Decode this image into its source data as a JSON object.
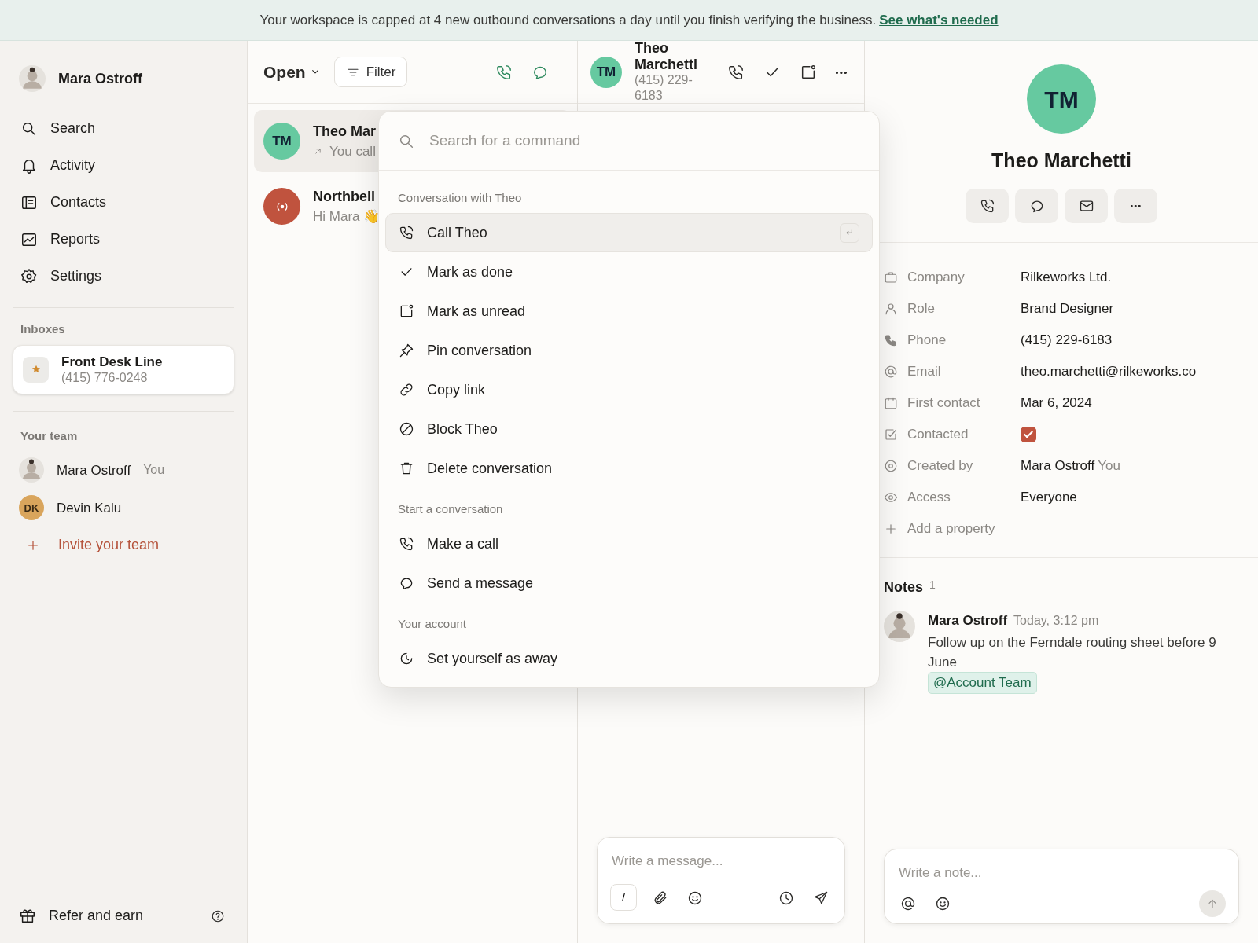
{
  "banner": {
    "text": "Your workspace is capped at 4 new outbound conversations a day until you finish verifying the business.",
    "link": "See what's needed"
  },
  "sidebar": {
    "user": {
      "name": "Mara Ostroff"
    },
    "nav": [
      {
        "label": "Search"
      },
      {
        "label": "Activity"
      },
      {
        "label": "Contacts"
      },
      {
        "label": "Reports"
      },
      {
        "label": "Settings"
      }
    ],
    "inboxes_title": "Inboxes",
    "inboxes": [
      {
        "name": "Front Desk Line",
        "phone": "(415) 776-0248"
      }
    ],
    "team_title": "Your team",
    "team": [
      {
        "kind": "photo",
        "name": "Mara Ostroff",
        "tag": "You"
      },
      {
        "kind": "initials",
        "name": "Devin Kalu",
        "initials": "DK"
      }
    ],
    "invite": "Invite your team",
    "footer": "Refer and earn"
  },
  "list": {
    "view": "Open",
    "filter": "Filter",
    "conversations": [
      {
        "kind": "initials",
        "initials": "TM",
        "color": "#66c9a0",
        "name": "Theo Mar",
        "preview": "You call",
        "selected": true
      },
      {
        "kind": "signal",
        "color": "#c0533e",
        "name": "Northbell",
        "preview": "Hi Mara 👋",
        "selected": false
      }
    ]
  },
  "conversation": {
    "initials": "TM",
    "name": "Theo Marchetti",
    "phone": "(415) 229-6183",
    "composer": {
      "placeholder": "Write a message...",
      "shortcut": "/"
    }
  },
  "palette": {
    "placeholder": "Search for a command",
    "sections": [
      {
        "title": "Conversation with Theo",
        "items": [
          {
            "label": "Call Theo",
            "selected": true,
            "hint": "↵"
          },
          {
            "label": "Mark as done",
            "selected": false
          },
          {
            "label": "Mark as unread",
            "selected": false
          },
          {
            "label": "Pin conversation",
            "selected": false
          },
          {
            "label": "Copy link",
            "selected": false
          },
          {
            "label": "Block Theo",
            "selected": false
          },
          {
            "label": "Delete conversation",
            "selected": false
          }
        ]
      },
      {
        "title": "Start a conversation",
        "items": [
          {
            "label": "Make a call",
            "selected": false
          },
          {
            "label": "Send a message",
            "selected": false
          }
        ]
      },
      {
        "title": "Your account",
        "items": [
          {
            "label": "Set yourself as away",
            "selected": false
          }
        ]
      }
    ]
  },
  "contact": {
    "initials": "TM",
    "name": "Theo Marchetti",
    "properties": [
      {
        "kind": "text",
        "label": "Company",
        "value": "Rilkeworks Ltd."
      },
      {
        "kind": "text",
        "label": "Role",
        "value": "Brand Designer"
      },
      {
        "kind": "text",
        "label": "Phone",
        "value": "(415) 229-6183"
      },
      {
        "kind": "text",
        "label": "Email",
        "value": "theo.marchetti@rilkeworks.co"
      },
      {
        "kind": "text",
        "label": "First contact",
        "value": "Mar 6, 2024"
      },
      {
        "kind": "checkbox",
        "label": "Contacted",
        "checked": true
      },
      {
        "kind": "person",
        "label": "Created by",
        "value": "Mara Ostroff",
        "tag": "You"
      },
      {
        "kind": "text",
        "label": "Access",
        "value": "Everyone"
      }
    ],
    "add_property": "Add a property",
    "notes_title": "Notes",
    "notes_count": "1",
    "notes": [
      {
        "author": "Mara Ostroff",
        "time": "Today, 3:12 pm",
        "text": "Follow up on the Ferndale routing sheet before 9 June",
        "mention": "@Account Team"
      }
    ],
    "note_composer": {
      "placeholder": "Write a note..."
    }
  }
}
